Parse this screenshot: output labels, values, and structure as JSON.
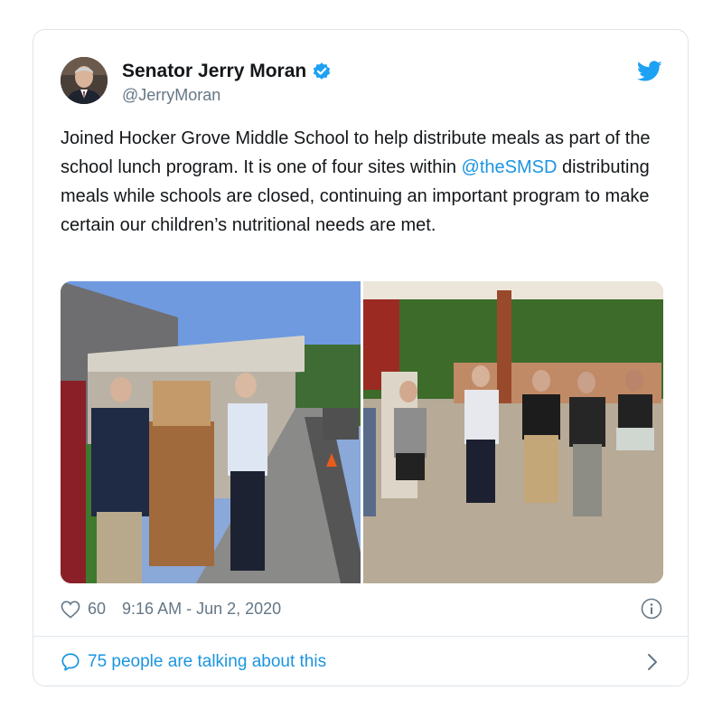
{
  "tweet": {
    "author_name": "Senator Jerry Moran",
    "author_handle": "@JerryMoran",
    "text_part1": "Joined Hocker Grove Middle School to help distribute meals as part of the school lunch program. It is one of four sites within ",
    "mention": "@theSMSD",
    "text_part2": " distributing meals while schools are closed, continuing an important program to make certain our children’s nutritional needs are met.",
    "likes": "60",
    "timestamp": "9:16 AM - Jun 2, 2020",
    "talking": "75 people are talking about this"
  },
  "icons": {
    "verified": "verified-badge-icon",
    "twitter": "twitter-bird-icon",
    "like": "heart-icon",
    "info": "info-icon",
    "reply": "speech-bubble-icon",
    "chevron": "chevron-right-icon"
  },
  "colors": {
    "accent": "#1da1f2",
    "link": "#1b95e0",
    "muted": "#657786"
  }
}
